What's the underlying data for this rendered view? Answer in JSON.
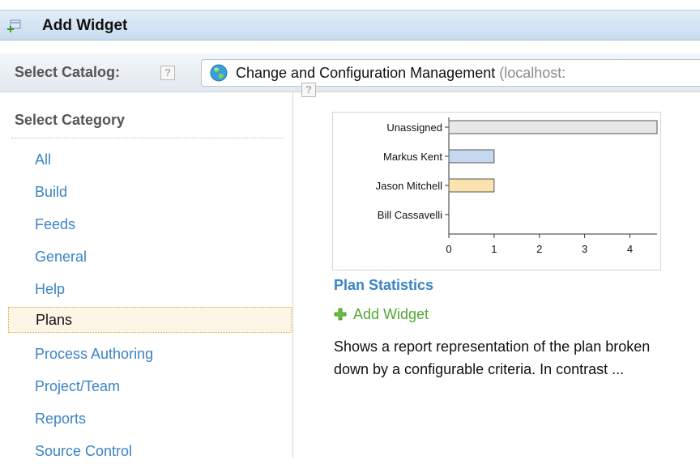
{
  "header": {
    "title": "Add Widget",
    "icon": "add-widget-icon"
  },
  "catalog": {
    "label": "Select Catalog:",
    "help": "?",
    "selected_name": "Change and Configuration Management",
    "selected_host": " (localhost:"
  },
  "category": {
    "heading": "Select Category",
    "items": [
      {
        "label": "All"
      },
      {
        "label": "Build"
      },
      {
        "label": "Feeds"
      },
      {
        "label": "General"
      },
      {
        "label": "Help"
      },
      {
        "label": "Plans",
        "selected": true
      },
      {
        "label": "Process Authoring"
      },
      {
        "label": "Project/Team"
      },
      {
        "label": "Reports"
      },
      {
        "label": "Source Control"
      }
    ]
  },
  "widget": {
    "help": "?",
    "title": "Plan Statistics",
    "add_label": "Add Widget",
    "description": "Shows a report representation of the plan broken down by a configurable criteria. In contrast ..."
  },
  "chart_data": {
    "type": "bar",
    "orientation": "horizontal",
    "categories": [
      "Unassigned",
      "Markus Kent",
      "Jason Mitchell",
      "Bill Cassavelli"
    ],
    "values": [
      4.6,
      1,
      1,
      0
    ],
    "colors": [
      "#e8e8e8",
      "#c5d8f0",
      "#fbe3b0",
      "#dddddd"
    ],
    "xticks": [
      0,
      1,
      2,
      3,
      4
    ],
    "xlim": [
      0,
      4.6
    ],
    "title": "",
    "xlabel": "",
    "ylabel": ""
  },
  "colors": {
    "link": "#3a84c6",
    "add": "#52a833",
    "selected_border": "#e8a33a"
  }
}
